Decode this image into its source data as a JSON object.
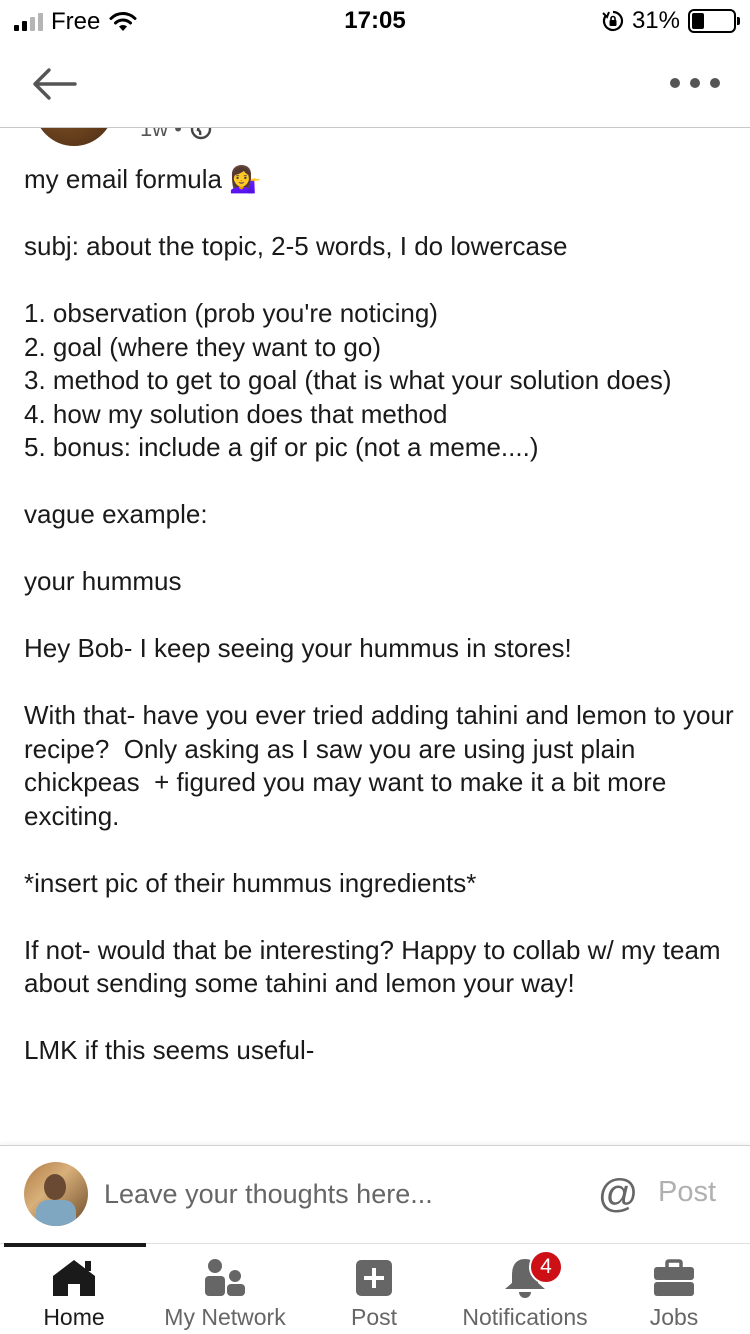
{
  "status_bar": {
    "carrier": "Free",
    "time": "17:05",
    "battery_percent": "31%",
    "battery_level": 0.31,
    "signal_bars_active": 2
  },
  "post": {
    "meta": "1w •",
    "lines": [
      "my email formula 💁‍♀️",
      "",
      "subj: about the topic, 2-5 words, I do lowercase",
      "",
      "1. observation (prob you're noticing)",
      "2. goal (where they want to go)",
      "3. method to get to goal (that is what your solution does)",
      "4. how my solution does that method",
      "5. bonus: include a gif or pic (not a meme....)",
      "",
      "vague example:",
      "",
      "your hummus",
      "",
      "Hey Bob- I keep seeing your hummus in stores!",
      "",
      "With that- have you ever tried adding tahini and lemon to your recipe?  Only asking as I saw you are using just plain chickpeas  + figured you may want to make it a bit more exciting.",
      "",
      "*insert pic of their hummus ingredients*",
      "",
      "If not- would that be interesting? Happy to collab w/ my team about sending some tahini and lemon your way!",
      "",
      "LMK if this seems useful-"
    ]
  },
  "comment_bar": {
    "placeholder": "Leave your thoughts here...",
    "mention_symbol": "@",
    "post_label": "Post"
  },
  "tabs": [
    {
      "label": "Home",
      "icon": "home-icon",
      "active": true
    },
    {
      "label": "My Network",
      "icon": "network-icon",
      "active": false
    },
    {
      "label": "Post",
      "icon": "post-plus-icon",
      "active": false
    },
    {
      "label": "Notifications",
      "icon": "bell-icon",
      "active": false,
      "badge": "4"
    },
    {
      "label": "Jobs",
      "icon": "briefcase-icon",
      "active": false
    }
  ],
  "colors": {
    "badge": "#cc1016",
    "text": "#1a1a1a",
    "muted": "#666666"
  }
}
